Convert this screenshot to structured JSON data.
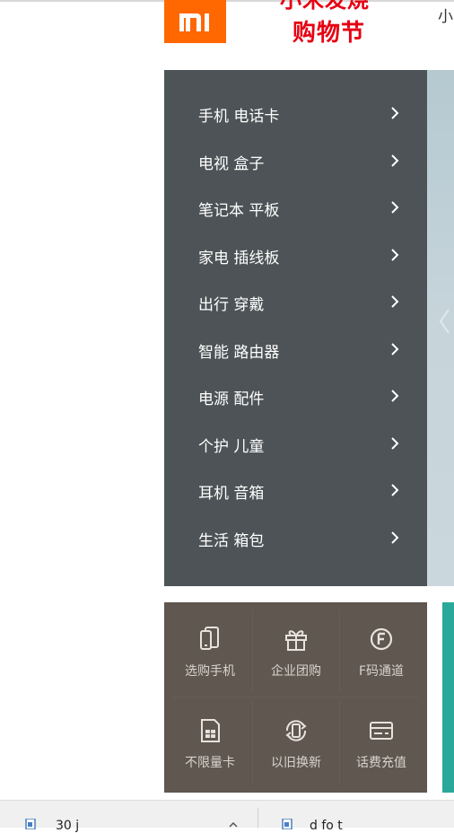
{
  "header": {
    "promo_line1": "小米发烧",
    "promo_line2": "购物节",
    "top_nav_fragment": "小"
  },
  "menu": {
    "items": [
      {
        "label": "手机 电话卡"
      },
      {
        "label": "电视 盒子"
      },
      {
        "label": "笔记本 平板"
      },
      {
        "label": "家电 插线板"
      },
      {
        "label": "出行 穿戴"
      },
      {
        "label": "智能 路由器"
      },
      {
        "label": "电源 配件"
      },
      {
        "label": "个护 儿童"
      },
      {
        "label": "耳机 音箱"
      },
      {
        "label": "生活 箱包"
      }
    ]
  },
  "quick_links": [
    {
      "label": "选购手机",
      "icon": "phone-icon"
    },
    {
      "label": "企业团购",
      "icon": "gift-icon"
    },
    {
      "label": "F码通道",
      "icon": "f-code-icon"
    },
    {
      "label": "不限量卡",
      "icon": "sim-card-icon"
    },
    {
      "label": "以旧换新",
      "icon": "trade-in-icon"
    },
    {
      "label": "话费充值",
      "icon": "credit-card-icon"
    }
  ],
  "downloads": {
    "item1": "30 j",
    "item2": "d       fo  t"
  },
  "colors": {
    "brand_orange": "#ff6700",
    "menu_bg": "#4d5356",
    "quick_bg": "#5f5750",
    "promo_red": "#e60012",
    "teal": "#2aa99a"
  }
}
